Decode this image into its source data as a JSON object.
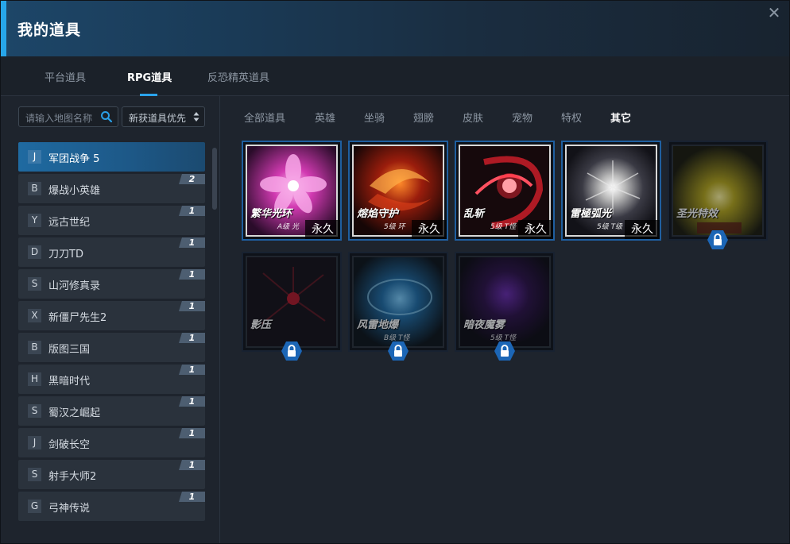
{
  "window": {
    "title": "我的道具",
    "close_glyph": "✕"
  },
  "tabs": [
    {
      "label": "平台道具"
    },
    {
      "label": "RPG道具",
      "active": true
    },
    {
      "label": "反恐精英道具"
    }
  ],
  "search": {
    "placeholder": "请输入地图名称",
    "icon": "search-icon"
  },
  "sort": {
    "value": "新获道具优先",
    "icon": "sort-arrows-icon"
  },
  "map_list": [
    {
      "letter": "J",
      "name": "军团战争 5",
      "count": "",
      "active": true
    },
    {
      "letter": "B",
      "name": "爆战小英雄",
      "count": "2"
    },
    {
      "letter": "Y",
      "name": "远古世纪",
      "count": "1"
    },
    {
      "letter": "D",
      "name": "刀刀TD",
      "count": "1"
    },
    {
      "letter": "S",
      "name": "山河修真录",
      "count": "1"
    },
    {
      "letter": "X",
      "name": "新僵尸先生2",
      "count": "1"
    },
    {
      "letter": "B",
      "name": "版图三国",
      "count": "1"
    },
    {
      "letter": "H",
      "name": "黑暗时代",
      "count": "1"
    },
    {
      "letter": "S",
      "name": "蜀汉之崛起",
      "count": "1"
    },
    {
      "letter": "J",
      "name": "剑破长空",
      "count": "1"
    },
    {
      "letter": "S",
      "name": "射手大师2",
      "count": "1"
    },
    {
      "letter": "G",
      "name": "弓神传说",
      "count": "1"
    }
  ],
  "categories": [
    {
      "label": "全部道具"
    },
    {
      "label": "英雄"
    },
    {
      "label": "坐骑"
    },
    {
      "label": "翅膀"
    },
    {
      "label": "皮肤"
    },
    {
      "label": "宠物"
    },
    {
      "label": "特权"
    },
    {
      "label": "其它",
      "active": true
    }
  ],
  "items": [
    {
      "art_label": "繁华光环",
      "art_sub": "A级 光",
      "permanence": "永久",
      "locked": false,
      "theme": "pink-flower"
    },
    {
      "art_label": "熔焰守护",
      "art_sub": "5级 环",
      "permanence": "永久",
      "locked": false,
      "theme": "fire"
    },
    {
      "art_label": "乱斩",
      "art_sub": "5级 T怪",
      "permanence": "永久",
      "locked": false,
      "theme": "red-slash"
    },
    {
      "art_label": "雷極弧光",
      "art_sub": "5级 T级",
      "permanence": "永久",
      "locked": false,
      "theme": "white-burst"
    },
    {
      "art_label": "圣光特效",
      "art_sub": "",
      "permanence": "",
      "locked": true,
      "theme": "yellow-glow",
      "lock_icon": "lock-icon"
    },
    {
      "art_label": "影压",
      "art_sub": "",
      "permanence": "",
      "locked": true,
      "theme": "dark-red",
      "lock_icon": "lock-icon"
    },
    {
      "art_label": "风雷地爆",
      "art_sub": "B级 T怪",
      "permanence": "",
      "locked": true,
      "theme": "blue-dome",
      "lock_icon": "lock-icon"
    },
    {
      "art_label": "暗夜魔雾",
      "art_sub": "5级 T怪",
      "permanence": "",
      "locked": true,
      "theme": "purple-mist",
      "lock_icon": "lock-icon"
    }
  ],
  "colors": {
    "accent": "#27a6ea",
    "active_item": "#1f6aa1",
    "badge": "#4d5e71",
    "lock": "#1c66b6"
  }
}
